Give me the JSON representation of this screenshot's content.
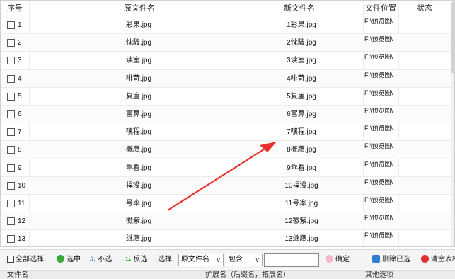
{
  "table": {
    "headers": {
      "index": "序号",
      "original_name": "原文件名",
      "new_name": "新文件名",
      "location": "文件位置",
      "status": "状态"
    },
    "rows": [
      {
        "index": "1",
        "original": "彩果.jpg",
        "new": "1彩果.jpg",
        "location": "F:\\预览图\\"
      },
      {
        "index": "2",
        "original": "忱騪.jpg",
        "new": "2忱騪.jpg",
        "location": "F:\\预览图\\"
      },
      {
        "index": "3",
        "original": "读室.jpg",
        "new": "3读室.jpg",
        "location": "F:\\预览图\\"
      },
      {
        "index": "4",
        "original": "啡苛.jpg",
        "new": "4啡苛.jpg",
        "location": "F:\\预览图\\"
      },
      {
        "index": "5",
        "original": "复崖.jpg",
        "new": "5复崖.jpg",
        "location": "F:\\预览图\\"
      },
      {
        "index": "6",
        "original": "富鼻.jpg",
        "new": "6富鼻.jpg",
        "location": "F:\\预览图\\"
      },
      {
        "index": "7",
        "original": "嘿程.jpg",
        "new": "7嘿程.jpg",
        "location": "F:\\预览图\\"
      },
      {
        "index": "8",
        "original": "概赝.jpg",
        "new": "8概赝.jpg",
        "location": "F:\\预览图\\"
      },
      {
        "index": "9",
        "original": "乖看.jpg",
        "new": "9乖看.jpg",
        "location": "F:\\预览图\\"
      },
      {
        "index": "10",
        "original": "捍没.jpg",
        "new": "10捍没.jpg",
        "location": "F:\\预览图\\"
      },
      {
        "index": "11",
        "original": "号率.jpg",
        "new": "11号率.jpg",
        "location": "F:\\预览图\\"
      },
      {
        "index": "12",
        "original": "徽紫.jpg",
        "new": "12徽紫.jpg",
        "location": "F:\\预览图\\"
      },
      {
        "index": "13",
        "original": "继赝.jpg",
        "new": "13继赝.jpg",
        "location": "F:\\预览图\\"
      }
    ]
  },
  "toolbar": {
    "select_all": "全部选择",
    "select": "选中",
    "deselect": "不选",
    "invert": "反选",
    "choose_label": "选择:",
    "field_select": "原文件名",
    "match_select": "包含",
    "confirm": "确定",
    "delete_selected": "删除已选",
    "clear_table": "清空表格"
  },
  "footer": {
    "filename": "文件名",
    "extension": "扩展名（后缀名，拓展名）",
    "other": "其他选项"
  },
  "colors": {
    "annotation_arrow": "#e8322b",
    "select_icon": "#3aa93a",
    "deselect_icon": "#4a7cc4",
    "invert_icon": "#3aa93a",
    "confirm_icon": "#f3b9c9",
    "delete_icon": "#2f7fd0",
    "clear_icon": "#e03131"
  }
}
